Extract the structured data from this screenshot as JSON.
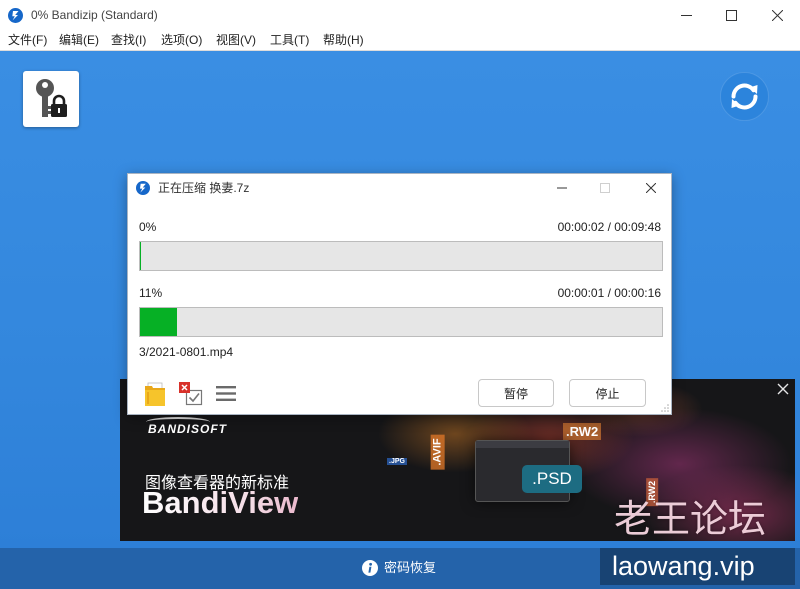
{
  "window": {
    "title": "0% Bandizip (Standard)",
    "app_icon": "bandizip-icon"
  },
  "menu": [
    "文件(F)",
    "编辑(E)",
    "查找(I)",
    "选项(O)",
    "视图(V)",
    "工具(T)",
    "帮助(H)"
  ],
  "toolbar": {
    "password_button_icon": "key-lock-icon",
    "refresh_button_icon": "refresh-icon"
  },
  "dialog": {
    "title": "正在压缩 换妻.7z",
    "overall": {
      "percent": "0%",
      "time": "00:00:02 / 00:09:48",
      "fill": 0
    },
    "current": {
      "percent": "11%",
      "time": "00:00:01 / 00:00:16",
      "fill": 0.07
    },
    "current_file": "3/2021-0801.mp4",
    "footer_icons": [
      "open-folder-icon",
      "close-when-done-icon",
      "menu-icon"
    ],
    "pause_label": "暂停",
    "stop_label": "停止"
  },
  "ad": {
    "brand": "BANDISOFT",
    "tagline": "图像查看器的新标准",
    "product": "BandiView",
    "format_labels": [
      ".AVIF",
      ".JPG",
      ".RW2",
      ".PSD",
      ".RW2"
    ]
  },
  "status_bar": {
    "label": "密码恢复",
    "icon": "info-icon"
  },
  "watermark": {
    "title": "老王论坛",
    "url": "laowang.vip"
  },
  "colors": {
    "background_blue": "#3a8ee3",
    "status_bar_blue": "#2463aa",
    "progress_green": "#06b025",
    "ad_background": "#161618"
  }
}
